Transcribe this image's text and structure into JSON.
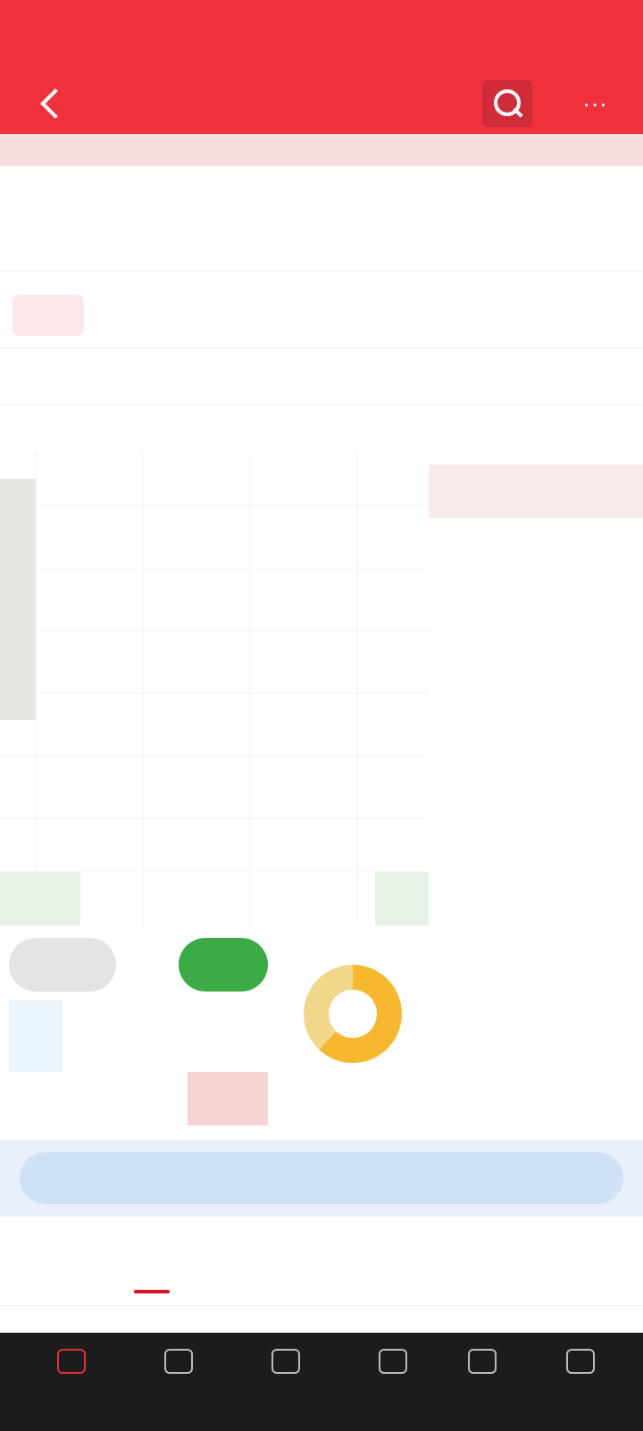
{
  "status": {
    "left": "",
    "right": ""
  },
  "header": {
    "name": "",
    "code": "",
    "more_label": "···"
  },
  "subtitle": "",
  "quote": {
    "price": "",
    "change": "",
    "change_pct": "",
    "fields": [
      {
        "k": "",
        "v": ""
      },
      {
        "k": "",
        "v": ""
      },
      {
        "k": "",
        "v": ""
      },
      {
        "k": "",
        "v": ""
      },
      {
        "k": "",
        "v": ""
      },
      {
        "k": "",
        "v": ""
      }
    ]
  },
  "banner": {
    "icon_text": "",
    "text": "",
    "tag": ""
  },
  "tabs": [
    "",
    "",
    "",
    "",
    "",
    "",
    ""
  ],
  "chart_info": {
    "a": "",
    "b": "",
    "c": ""
  },
  "book": {
    "head_left": "",
    "head_right": "",
    "mid": "",
    "rows": [
      {
        "t": "",
        "p": "",
        "q": ""
      },
      {
        "t": "",
        "p": "",
        "q": ""
      },
      {
        "t": "",
        "p": "",
        "q": ""
      },
      {
        "t": "",
        "p": "",
        "q": ""
      },
      {
        "t": "",
        "p": "",
        "q": ""
      },
      {
        "t": "",
        "p": "",
        "q": ""
      },
      {
        "t": "",
        "p": "",
        "q": ""
      },
      {
        "t": "",
        "p": "",
        "q": ""
      },
      {
        "t": "",
        "p": "",
        "q": ""
      },
      {
        "t": "",
        "p": "",
        "q": ""
      },
      {
        "t": "",
        "p": "",
        "q": ""
      },
      {
        "t": "",
        "p": "",
        "q": ""
      },
      {
        "t": "",
        "p": "",
        "q": ""
      }
    ]
  },
  "flow": {
    "pill_a": "",
    "pill_b": "",
    "bottom_a": "",
    "bottom_b": "",
    "bottom_c": ""
  },
  "notice": "",
  "detail_tabs": [
    "",
    "",
    "",
    "",
    "",
    ""
  ],
  "bottom_bar": [
    "",
    "",
    "",
    "",
    "",
    ""
  ],
  "colors": {
    "brand_red": "#f0303a",
    "up": "#e03030",
    "down": "#2e9a3e",
    "notice_blue": "#3474c8"
  }
}
